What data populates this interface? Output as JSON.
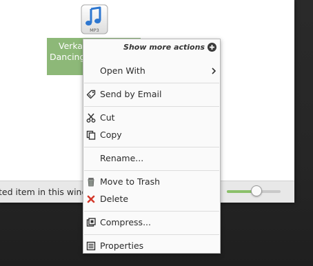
{
  "status_bar": {
    "text": "ted item in this window",
    "zoom_level": 0.55
  },
  "file": {
    "icon_label": "MP3",
    "name_line1": "Verka",
    "name_line2": "Dancing"
  },
  "context_menu": {
    "show_more_label": "Show more actions",
    "items": [
      {
        "label": "Open With",
        "icon": "",
        "submenu": true
      },
      {
        "label": "Send by Email",
        "icon": "tag-icon"
      },
      {
        "label": "Cut",
        "icon": "scissors-icon"
      },
      {
        "label": "Copy",
        "icon": "copy-icon"
      },
      {
        "label": "Rename...",
        "icon": ""
      },
      {
        "label": "Move to Trash",
        "icon": "trash-icon"
      },
      {
        "label": "Delete",
        "icon": "delete-x-icon"
      },
      {
        "label": "Compress...",
        "icon": "compress-icon"
      },
      {
        "label": "Properties",
        "icon": "properties-icon"
      }
    ]
  },
  "colors": {
    "selection_green": "#8db878",
    "slider_fill": "#8bc06a",
    "delete_red": "#d33a2c",
    "mp3_blue": "#2e77d0"
  }
}
